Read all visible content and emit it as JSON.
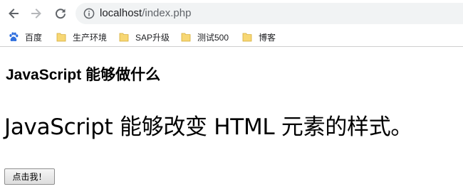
{
  "browser": {
    "url_host": "localhost",
    "url_path": "/index.php",
    "icons": {
      "back": "arrow-left-icon",
      "forward": "arrow-right-icon",
      "reload": "reload-icon",
      "site_info": "info-icon"
    },
    "bookmarks": [
      {
        "label": "百度",
        "icon": "baidu-paw-icon"
      },
      {
        "label": "生产环境",
        "icon": "folder-icon"
      },
      {
        "label": "SAP升级",
        "icon": "folder-icon"
      },
      {
        "label": "测试500",
        "icon": "folder-icon"
      },
      {
        "label": "博客",
        "icon": "folder-icon"
      }
    ],
    "colors": {
      "omnibox_bg": "#f1f3f4",
      "folder_yellow": "#f7d774",
      "baidu_blue": "#2f6fde"
    }
  },
  "page": {
    "heading": "JavaScript 能够做什么",
    "demo_text": "JavaScript 能够改变 HTML 元素的样式。",
    "button_label": "点击我！"
  }
}
